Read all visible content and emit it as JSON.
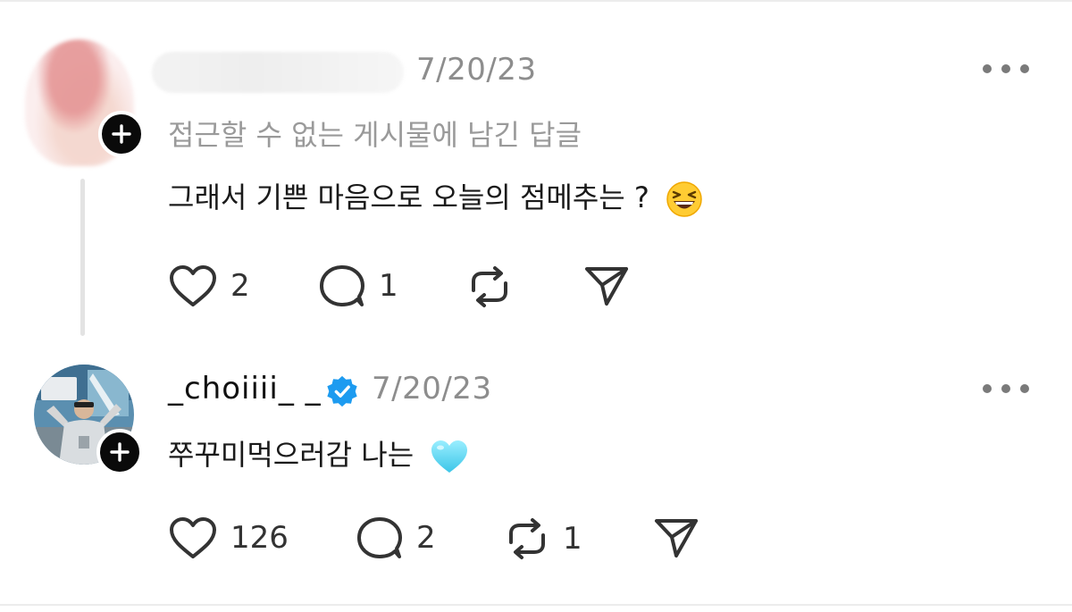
{
  "posts": [
    {
      "username": "",
      "date": "7/20/23",
      "context": "접근할 수 없는 게시물에 남긴 답글",
      "text": "그래서 기쁜 마음으로 오늘의 점메추는 ?",
      "emoji": "grinning-squinting-face",
      "likes": "2",
      "replies": "1",
      "reposts": "",
      "verified": false
    },
    {
      "username": "_choiiii_ _",
      "date": "7/20/23",
      "context": "",
      "text": "쭈꾸미먹으러감 나는",
      "emoji": "light-blue-heart",
      "likes": "126",
      "replies": "2",
      "reposts": "1",
      "verified": true
    }
  ],
  "colors": {
    "verified_blue": "#1d9bf0",
    "badge_black": "#0a0a0a",
    "muted_text": "#8d8d8d",
    "heart_cyan": "#5ad8f0"
  }
}
